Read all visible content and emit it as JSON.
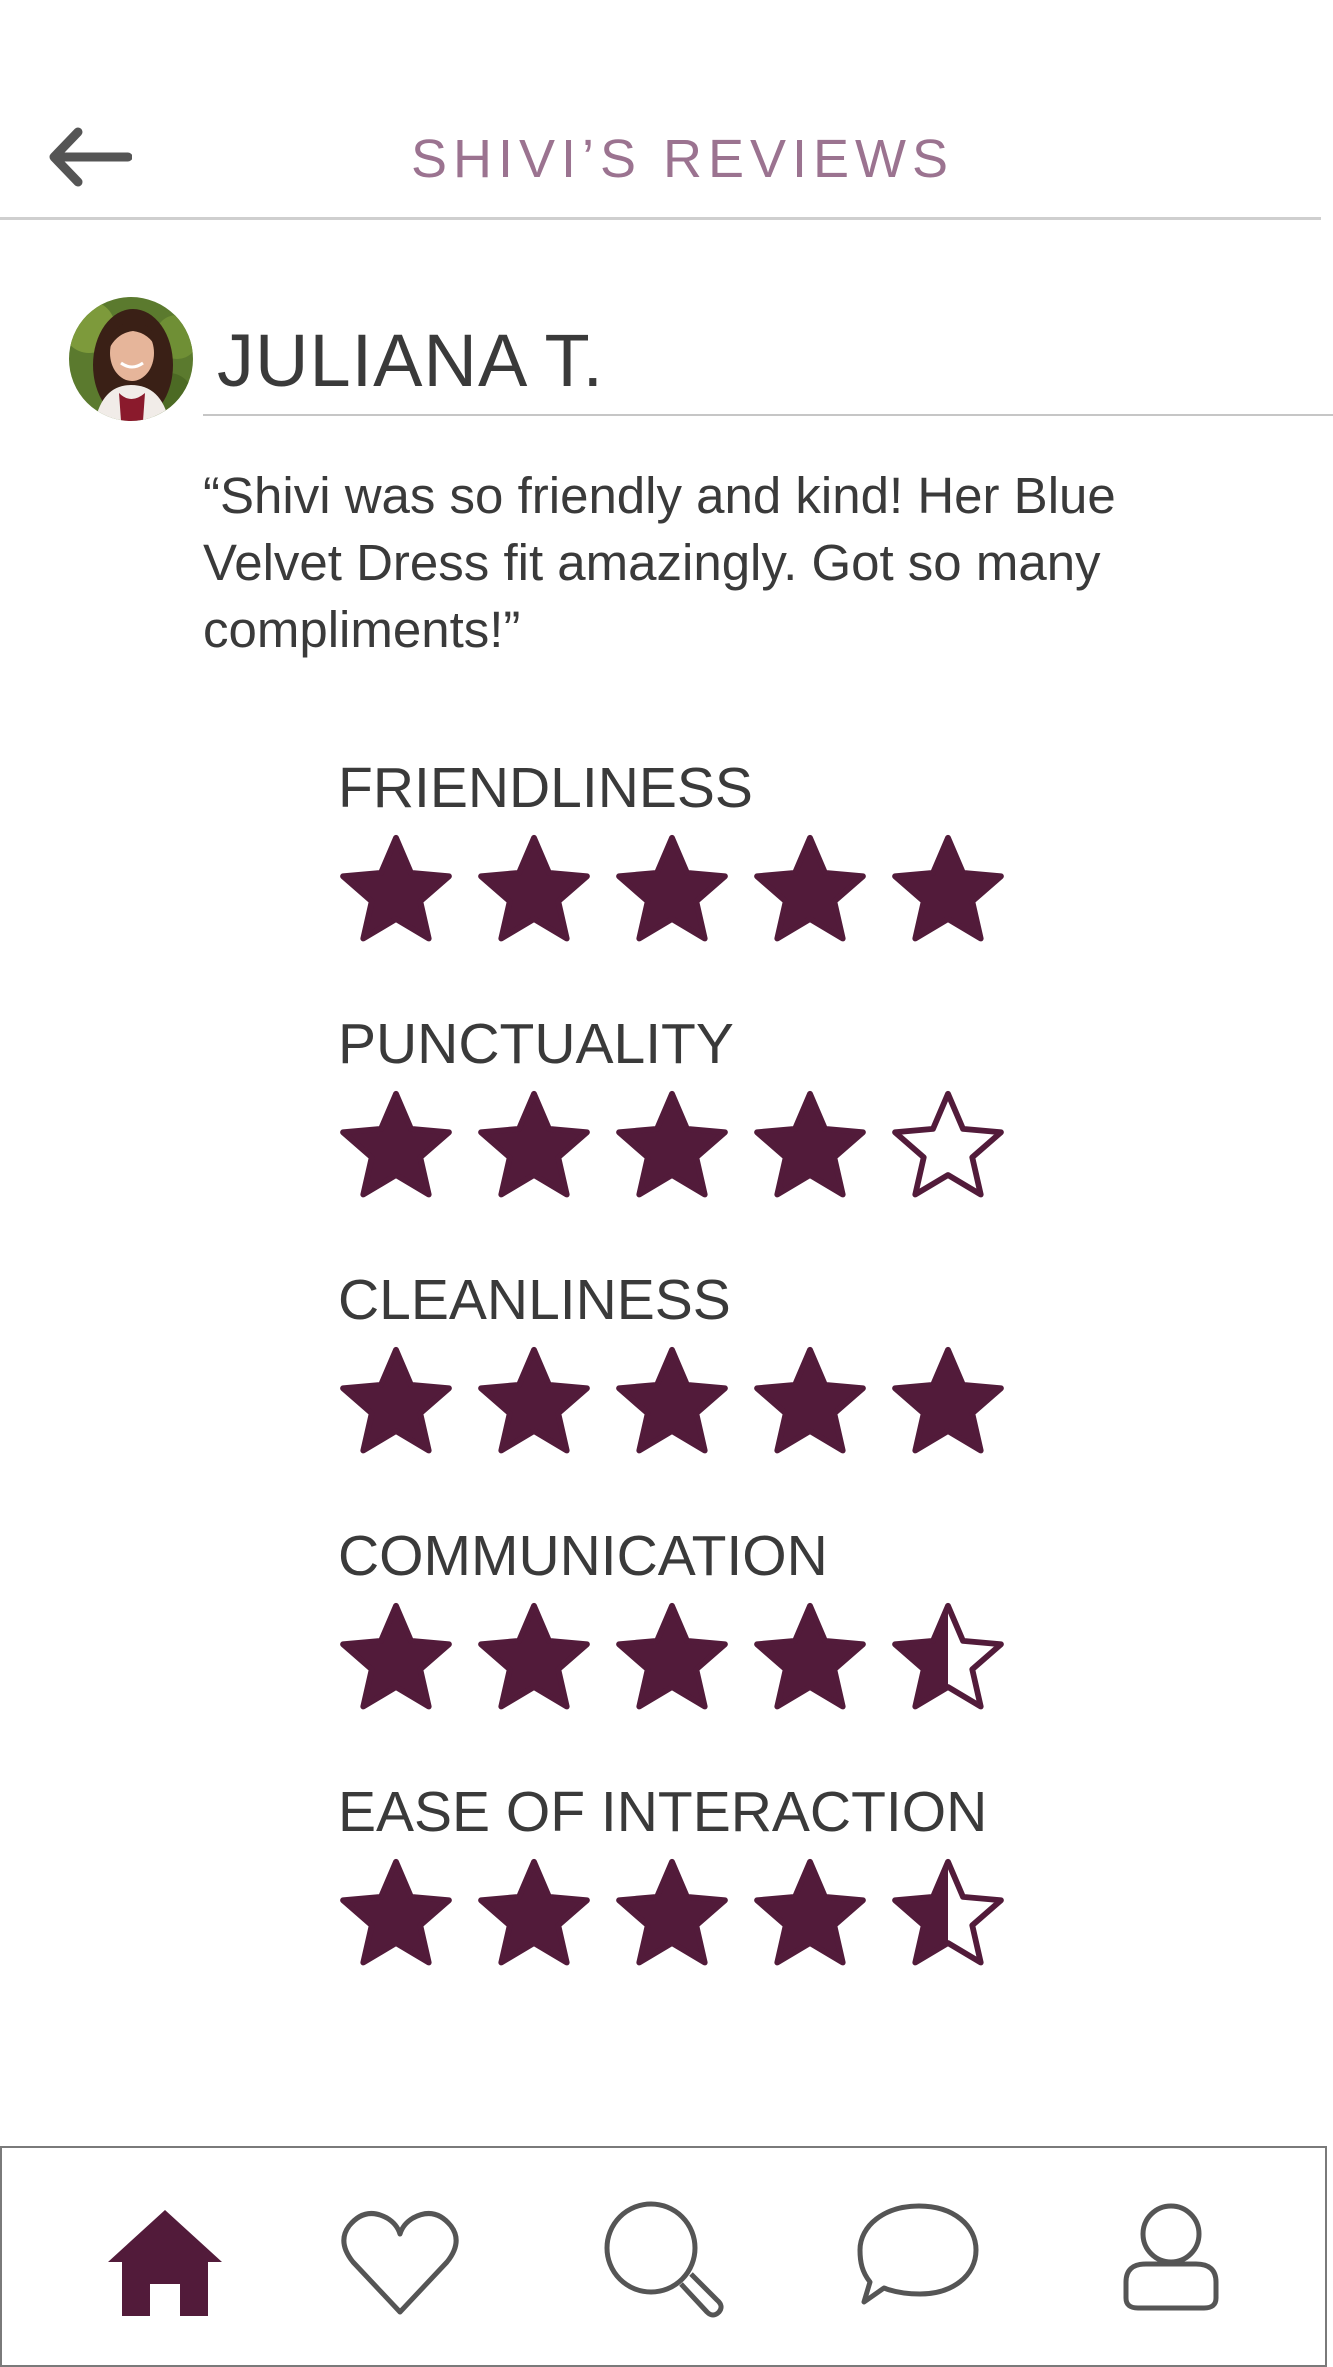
{
  "header": {
    "title": "SHIVI’S REVIEWS",
    "back_icon": "back-arrow-icon"
  },
  "review": {
    "reviewer_name": "JULIANA T.",
    "avatar": "reviewer-avatar",
    "text": "“Shivi was so friendly and kind! Her Blue Velvet Dress fit amazingly. Got so many compliments!”"
  },
  "ratings": [
    {
      "label": "FRIENDLINESS",
      "score": 5,
      "max": 5
    },
    {
      "label": "PUNCTUALITY",
      "score": 4,
      "max": 5
    },
    {
      "label": "CLEANLINESS",
      "score": 5,
      "max": 5
    },
    {
      "label": "COMMUNICATION",
      "score": 4.5,
      "max": 5
    },
    {
      "label": "EASE OF INTERACTION",
      "score": 4.5,
      "max": 5
    }
  ],
  "nav": {
    "items": [
      {
        "name": "home",
        "icon": "home-icon",
        "active": true
      },
      {
        "name": "favorites",
        "icon": "heart-icon",
        "active": false
      },
      {
        "name": "search",
        "icon": "search-icon",
        "active": false
      },
      {
        "name": "messages",
        "icon": "chat-icon",
        "active": false
      },
      {
        "name": "profile",
        "icon": "profile-icon",
        "active": false
      }
    ]
  },
  "colors": {
    "accent": "#521b3a",
    "title": "#9b7390",
    "text": "#3a3a3a",
    "icon_inactive": "#555555"
  }
}
